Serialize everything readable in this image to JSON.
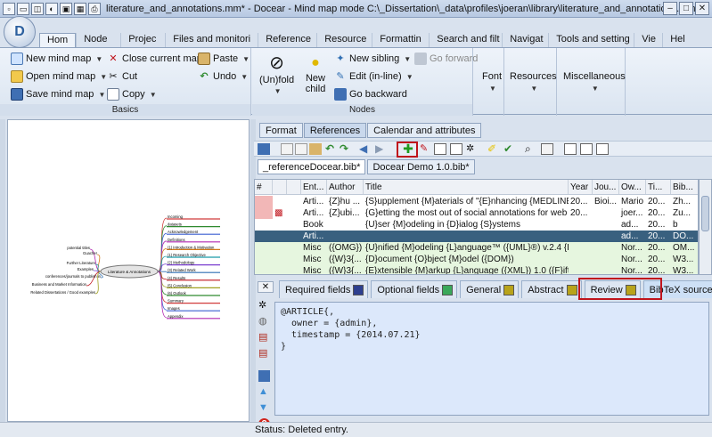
{
  "window": {
    "title": "literature_and_annotations.mm* - Docear - Mind map mode C:\\_Dissertation\\_data\\profiles\\joeran\\library\\literature_and_annotations.mm",
    "logo_text": "D"
  },
  "ribbon_tabs": [
    "Hom",
    "Node",
    "Projec",
    "Files and monitori",
    "Reference",
    "Resource",
    "Formattin",
    "Search and filt",
    "Navigat",
    "Tools and setting",
    "Vie",
    "Hel"
  ],
  "ribbon": {
    "basics": {
      "label": "Basics",
      "new_mind_map": "New mind map",
      "open_mind_map": "Open mind map",
      "save_mind_map": "Save mind map",
      "close_current_map": "Close current map",
      "cut": "Cut",
      "copy": "Copy",
      "paste": "Paste",
      "undo": "Undo"
    },
    "nodes": {
      "label": "Nodes",
      "unfold": "(Un)fold",
      "new_child": "New child",
      "new_sibling": "New sibling",
      "edit_inline": "Edit (in-line)",
      "go_backward": "Go backward",
      "go_forward": "Go forward"
    },
    "font": "Font",
    "resources": "Resources",
    "misc": "Miscellaneous"
  },
  "mindmap": {
    "root": "Literature & Annotations",
    "right_nodes": [
      "Incoming",
      "datasets",
      "Acknowledgement",
      "Definitions",
      "(1) Introduction & Motivation",
      "(1) Research Objective",
      "(2) Methodology",
      "(3) Related Work",
      "(4) Results",
      "(5) Conclusion",
      "(6) Outlook",
      "Summary",
      "Images",
      "Appendix"
    ],
    "left_nodes": [
      "potential titles",
      "Guacher",
      "Further Literature",
      "Examples",
      "conferences/journals to publish in",
      "Business and Market Information",
      "Related Dissertations / Good examples"
    ]
  },
  "right_tabs": [
    "Format",
    "References",
    "Calendar and attributes"
  ],
  "db_tabs": [
    "_referenceDocear.bib*",
    "Docear Demo 1.0.bib*"
  ],
  "table": {
    "headers": [
      "#",
      "",
      "",
      "Ent...",
      "Author",
      "Title",
      "Year",
      "Jou...",
      "Ow...",
      "Ti...",
      "Bib..."
    ],
    "rows": [
      [
        "",
        "",
        "",
        "Arti...",
        "{Z}hu ...",
        "{S}upplement {M}aterials of \"{E}nhancing {MEDLINE} ...",
        "20...",
        "Bioi...",
        "Mario",
        "20...",
        "Zh..."
      ],
      [
        "",
        "pdf",
        "",
        "Arti...",
        "{Z}ubi...",
        "{G}etting the most out of social annotations for web p...",
        "20...",
        "",
        "joer...",
        "20...",
        "Zu..."
      ],
      [
        "",
        "",
        "",
        "Book",
        "",
        "{U}ser {M}odeling in {D}ialog {S}ystems",
        "",
        "",
        "ad...",
        "20...",
        "b"
      ],
      [
        "",
        "",
        "",
        "Arti...",
        "",
        "",
        "",
        "",
        "ad...",
        "20...",
        "DO..."
      ],
      [
        "",
        "",
        "",
        "Misc",
        "({OMG})",
        "{U}nified {M}odeling {L}anguage™ ({UML}®) v.2.4 {B}...",
        "",
        "",
        "Nor...",
        "20...",
        "OM..."
      ],
      [
        "",
        "",
        "",
        "Misc",
        "({W}3{...",
        "{D}ocument {O}bject {M}odel ({DOM})",
        "",
        "",
        "Nor...",
        "20...",
        "W3..."
      ],
      [
        "",
        "",
        "",
        "Misc",
        "({W}3{...",
        "{E}xtensible {M}arkup {L}anguage ({XML}) 1.0 ({F}ifth ...",
        "",
        "",
        "Nor...",
        "20...",
        "W3..."
      ]
    ]
  },
  "field_tabs": [
    {
      "label": "Required fields",
      "color": "#2d3f8f"
    },
    {
      "label": "Optional fields",
      "color": "#3aa85a"
    },
    {
      "label": "General",
      "color": "#b8a31a"
    },
    {
      "label": "Abstract",
      "color": "#b8a31a"
    },
    {
      "label": "Review",
      "color": "#b8a31a"
    },
    {
      "label": "BibTeX source",
      "color": "#2f5f9e"
    }
  ],
  "bibtex_source": "@ARTICLE{,\n  owner = {admin},\n  timestamp = {2014.07.21}\n}",
  "status": "Status: Deleted entry.",
  "colors": {
    "highlight": "#c0141c",
    "selected_row": "#39607f"
  }
}
